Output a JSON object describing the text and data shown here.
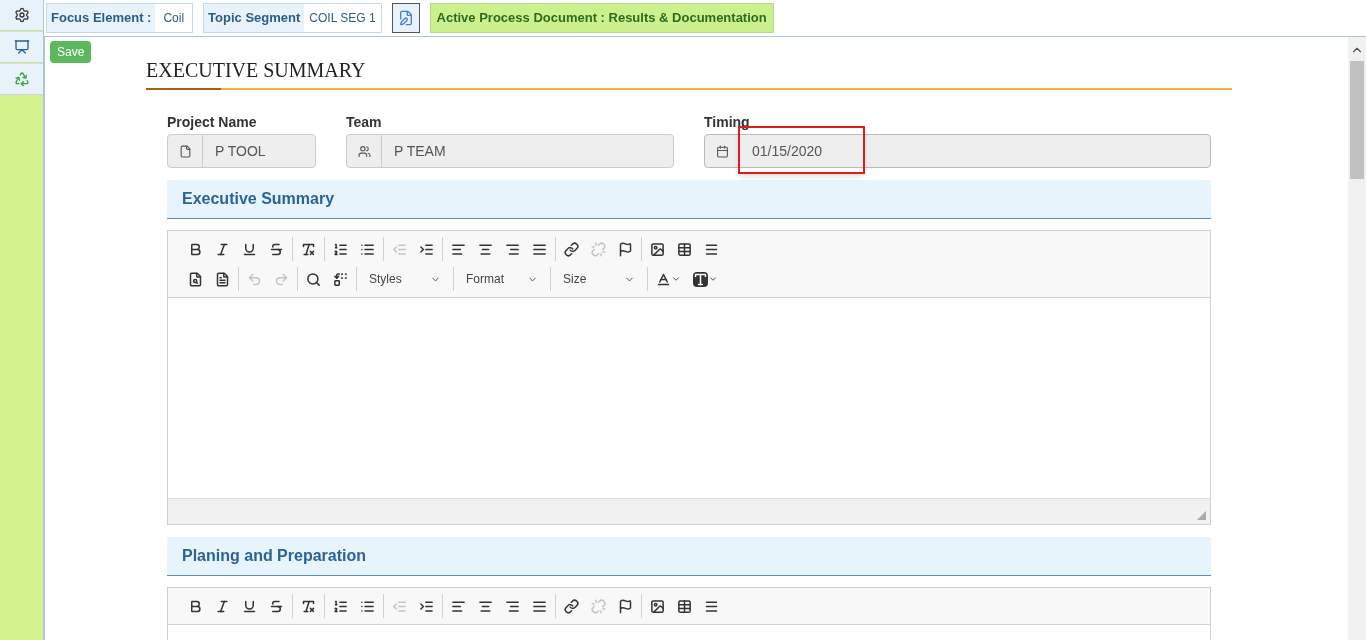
{
  "top_bar": {
    "focus_element": {
      "label": "Focus Element :",
      "value": "Coil"
    },
    "topic_segment": {
      "label": "Topic Segment",
      "value": "COIL SEG 1"
    },
    "active_document": "Active Process Document : Results & Documentation"
  },
  "save_button": "Save",
  "page_title": "EXECUTIVE SUMMARY",
  "fields": [
    {
      "label": "Project Name",
      "value": "P TOOL",
      "kind": "file",
      "highlighted": false
    },
    {
      "label": "Team",
      "value": "P TEAM",
      "kind": "team",
      "highlighted": false
    },
    {
      "label": "Timing",
      "value": "01/15/2020",
      "kind": "date",
      "highlighted": true
    }
  ],
  "toolbar": {
    "row_1": [
      [
        {
          "kind": "bold",
          "disabled": false
        },
        {
          "kind": "italic",
          "disabled": false
        },
        {
          "kind": "underline",
          "disabled": false
        },
        {
          "kind": "strike",
          "disabled": false
        }
      ],
      [
        {
          "kind": "clear",
          "disabled": false
        }
      ],
      [
        {
          "kind": "numbered",
          "disabled": false
        },
        {
          "kind": "bulleted",
          "disabled": false
        }
      ],
      [
        {
          "kind": "outdent",
          "disabled": true
        },
        {
          "kind": "indent",
          "disabled": false
        }
      ],
      [
        {
          "kind": "left",
          "disabled": false
        },
        {
          "kind": "center",
          "disabled": false
        },
        {
          "kind": "right",
          "disabled": false
        },
        {
          "kind": "justify",
          "disabled": false
        }
      ],
      [
        {
          "kind": "link",
          "disabled": false
        },
        {
          "kind": "unlink",
          "disabled": true
        },
        {
          "kind": "anchor",
          "disabled": false
        }
      ],
      [
        {
          "kind": "image",
          "disabled": false
        },
        {
          "kind": "table",
          "disabled": false
        },
        {
          "kind": "rule",
          "disabled": false
        }
      ]
    ],
    "row_2": [
      [
        {
          "kind": "preview",
          "disabled": false
        },
        {
          "kind": "document",
          "disabled": false
        }
      ],
      [
        {
          "kind": "undo",
          "disabled": true
        },
        {
          "kind": "redo",
          "disabled": true
        }
      ],
      [
        {
          "kind": "find",
          "disabled": false
        },
        {
          "kind": "replace",
          "disabled": false
        }
      ]
    ],
    "row_2_end": [
      [
        {
          "kind": "textcolor",
          "disabled": false
        },
        {
          "kind": "bgcolor",
          "disabled": false
        }
      ]
    ]
  },
  "editors": [
    {
      "title": "Executive Summary",
      "dropdowns": [
        "Styles",
        "Format",
        "Size"
      ]
    },
    {
      "title": "Planing and Preparation"
    }
  ]
}
